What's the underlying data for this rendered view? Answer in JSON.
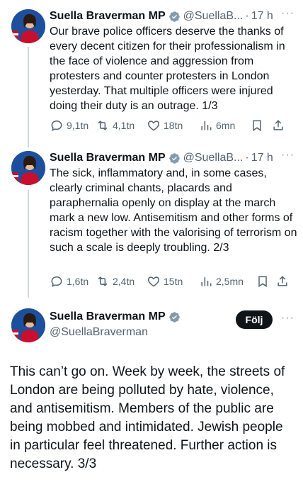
{
  "tweets": [
    {
      "name": "Suella Braverman MP",
      "handle": "@SuellaB...",
      "dot": "·",
      "time": "17 h",
      "more": "···",
      "text": "Our brave police officers deserve the thanks of every decent citizen for their professionalism in the face of violence and aggression from protesters and counter protesters in London yesterday. That multiple officers were injured doing their duty is an outrage. 1/3",
      "replies": "9,1tn",
      "reposts": "4,1tn",
      "likes": "18tn",
      "views": "6mn"
    },
    {
      "name": "Suella Braverman MP",
      "handle": "@SuellaB...",
      "dot": "·",
      "time": "17 h",
      "more": "···",
      "text": "The sick, inflammatory and, in some cases, clearly criminal chants, placards and paraphernalia openly on display at the march mark a new low. Antisemitism and other forms of racism together with the valorising of terrorism on such a scale is deeply troubling. 2/3",
      "replies": "1,6tn",
      "reposts": "2,4tn",
      "likes": "15tn",
      "views": "2,5mn"
    }
  ],
  "main_tweet": {
    "name": "Suella Braverman MP",
    "handle": "@SuellaBraverman",
    "follow_label": "Följ",
    "more": "···",
    "text": "This can’t go on. Week by week, the streets of London are being polluted by hate, violence, and antisemitism. Members of the public are being mobbed and intimidated. Jewish people in particular feel threatened. Further action is necessary. 3/3"
  },
  "colors": {
    "verified": "#829aab",
    "avatar_bg": "#1d4f9c",
    "avatar_red": "#c8102e",
    "follow_bg": "#0f1419",
    "muted": "#536471"
  },
  "icons": [
    "verified-badge-icon",
    "reply-icon",
    "repost-icon",
    "like-icon",
    "views-icon",
    "bookmark-icon",
    "share-icon",
    "more-icon"
  ]
}
